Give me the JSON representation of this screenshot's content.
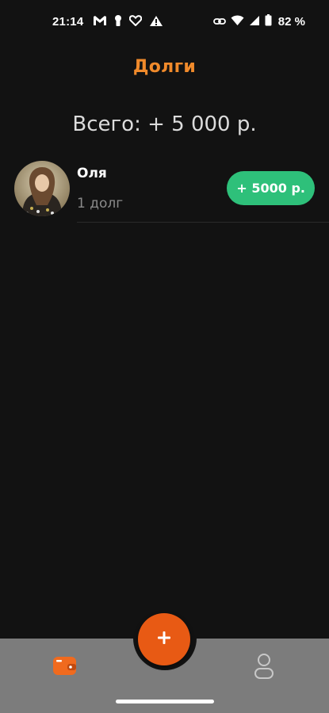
{
  "status_bar": {
    "time": "21:14",
    "battery": "82 %",
    "left_icons": [
      "gmail-icon",
      "keyhole-icon",
      "heart-icon",
      "warning-icon"
    ],
    "right_icons": [
      "link-icon",
      "wifi-icon",
      "signal-icon",
      "battery-icon"
    ]
  },
  "header": {
    "title": "Долги",
    "total": "Всего: + 5 000 р."
  },
  "debts": [
    {
      "name": "Оля",
      "count": "1 долг",
      "amount": "+ 5000 р."
    }
  ],
  "bottom_nav": {
    "fab_icon": "plus-icon",
    "items": [
      "wallet-icon",
      "profile-icon"
    ]
  },
  "colors": {
    "accent": "#f08a2b",
    "fab": "#e85a14",
    "positive": "#2ec07a",
    "background": "#121212",
    "nav_background": "#7c7c7c"
  }
}
